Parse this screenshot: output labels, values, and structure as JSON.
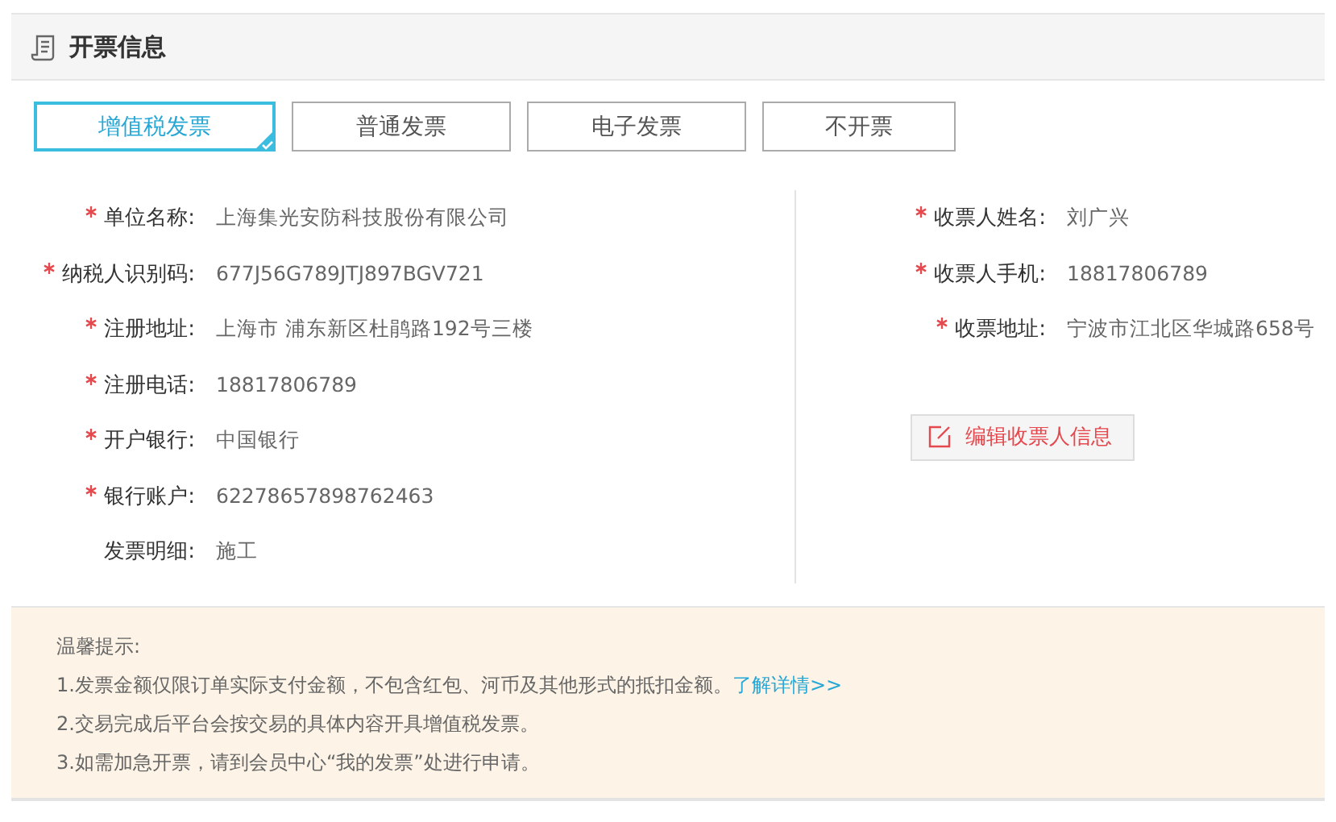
{
  "header": {
    "title": "开票信息"
  },
  "tabs": [
    {
      "label": "增值税发票",
      "selected": true
    },
    {
      "label": "普通发票",
      "selected": false
    },
    {
      "label": "电子发票",
      "selected": false
    },
    {
      "label": "不开票",
      "selected": false
    }
  ],
  "invoice_fields": [
    {
      "label": "单位名称:",
      "value": "上海集光安防科技股份有限公司",
      "required": true
    },
    {
      "label": "纳税人识别码:",
      "value": "677J56G789JTJ897BGV721",
      "required": true
    },
    {
      "label": "注册地址:",
      "value": "上海市 浦东新区杜鹃路192号三楼",
      "required": true
    },
    {
      "label": "注册电话:",
      "value": "18817806789",
      "required": true
    },
    {
      "label": "开户银行:",
      "value": "中国银行",
      "required": true
    },
    {
      "label": "银行账户:",
      "value": "62278657898762463",
      "required": true
    },
    {
      "label": "发票明细:",
      "value": "施工",
      "required": false
    }
  ],
  "recipient_fields": [
    {
      "label": "收票人姓名:",
      "value": "刘广兴",
      "required": true
    },
    {
      "label": "收票人手机:",
      "value": "18817806789",
      "required": true
    },
    {
      "label": "收票地址:",
      "value": "宁波市江北区华城路658号",
      "required": true
    }
  ],
  "edit_button": "编辑收票人信息",
  "tips": {
    "title": "温馨提示:",
    "lines": [
      {
        "text": "1.发票金额仅限订单实际支付金额，不包含红包、河币及其他形式的抵扣金额。",
        "link": "了解详情>>"
      },
      {
        "text": "2.交易完成后平台会按交易的具体内容开具增值税发票。"
      },
      {
        "text": "3.如需加急开票，请到会员中心“我的发票”处进行申请。"
      }
    ]
  }
}
